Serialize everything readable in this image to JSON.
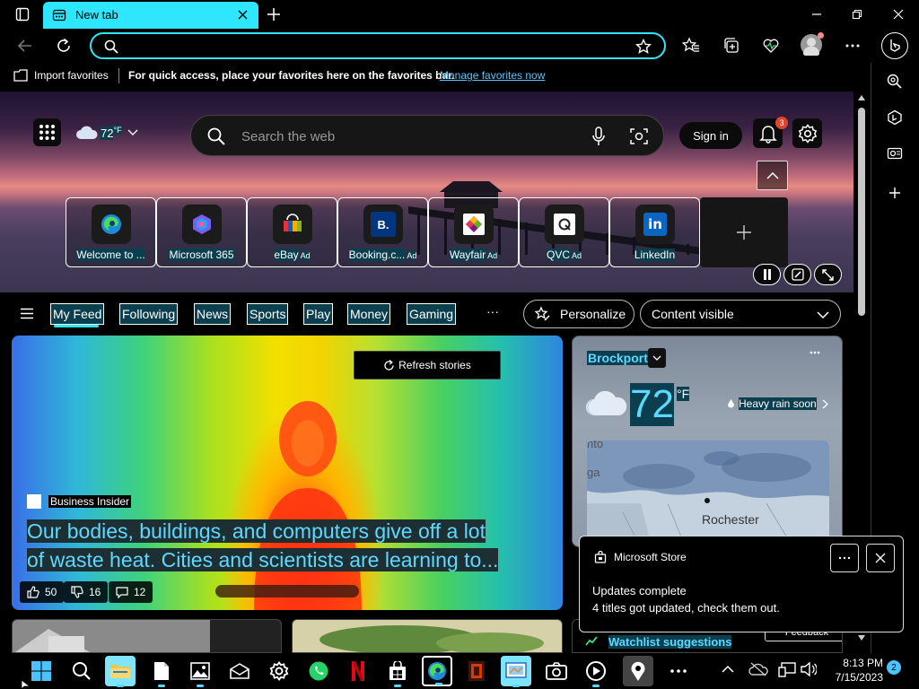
{
  "browser": {
    "tab_title": "New tab",
    "address_value": "",
    "favorites": {
      "import_label": "Import favorites",
      "message": "For quick access, place your favorites here on the favorites bar.",
      "manage_link": "Manage favorites now"
    }
  },
  "hero": {
    "temperature": "72",
    "temp_unit": "°F",
    "search_placeholder": "Search the web",
    "sign_in": "Sign in",
    "notification_count": "3",
    "tiles": [
      {
        "label": "Welcome to ...",
        "ad": ""
      },
      {
        "label": "Microsoft 365",
        "ad": ""
      },
      {
        "label": "eBay",
        "ad": "Ad"
      },
      {
        "label": "Booking.c...",
        "ad": "Ad"
      },
      {
        "label": "Wayfair",
        "ad": "Ad"
      },
      {
        "label": "QVC",
        "ad": "Ad"
      },
      {
        "label": "LinkedIn",
        "ad": ""
      }
    ]
  },
  "feed_nav": {
    "items": [
      "My Feed",
      "Following",
      "News",
      "Sports",
      "Play",
      "Money",
      "Gaming"
    ],
    "more": "···",
    "personalize": "Personalize",
    "content_visible": "Content visible"
  },
  "main_story": {
    "refresh": "Refresh stories",
    "source": "Business Insider",
    "headline_line1": "Our bodies, buildings, and computers give off a lot",
    "headline_line2": "of waste heat. Cities and scientists are learning to...",
    "likes": "50",
    "dislikes": "16",
    "comments": "12"
  },
  "weather": {
    "location": "Brockport",
    "temp": "72",
    "unit": "°F",
    "condition": "Heavy rain soon",
    "map_city": "Rochester",
    "map_edge_top": "nto",
    "map_edge_mid": "ga"
  },
  "toast": {
    "app": "Microsoft Store",
    "title": "Updates complete",
    "body": "4 titles got updated, check them out."
  },
  "lower": {
    "watchlist": "Watchlist suggestions",
    "feedback": "Feedback"
  },
  "taskbar": {
    "time": "8:13 PM",
    "date": "7/15/2023",
    "badge": "2"
  },
  "colors": {
    "accent": "#2fe6ff",
    "link": "#5fc4ff",
    "highlight_bg": "#0b3f4f",
    "headline": "#5fd8ff"
  }
}
